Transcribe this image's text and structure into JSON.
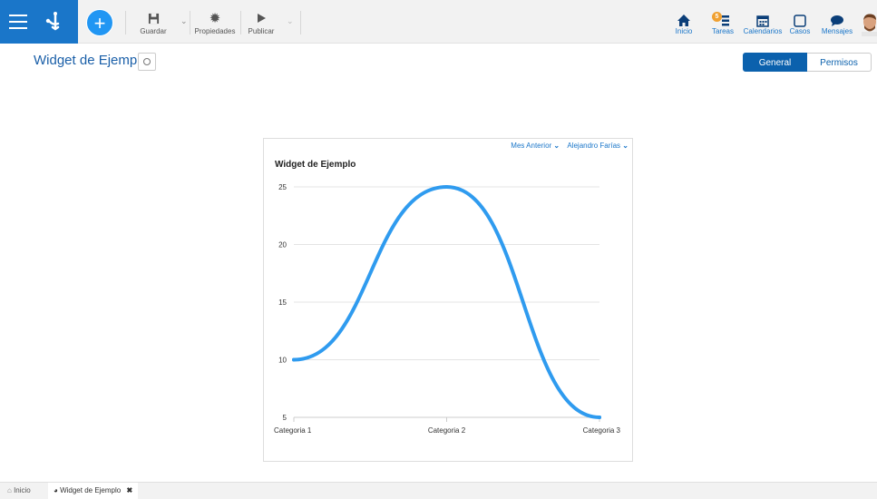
{
  "toolbar": {
    "save_label": "Guardar",
    "properties_label": "Propiedades",
    "publish_label": "Publicar",
    "add_label": "+"
  },
  "nav": {
    "home_label": "Inicio",
    "tasks_label": "Tareas",
    "tasks_badge": "5",
    "calendars_label": "Calendarios",
    "cases_label": "Casos",
    "messages_label": "Mensajes"
  },
  "page": {
    "title": "Widget de Ejemplo"
  },
  "tabs": {
    "general": "General",
    "permissions": "Permisos"
  },
  "widget": {
    "filter_period": "Mes Anterior",
    "filter_user": "Alejandro Farías",
    "title": "Widget de Ejemplo"
  },
  "chart_data": {
    "type": "line",
    "title": "Widget de Ejemplo",
    "categories": [
      "Categoria 1",
      "Categoria 2",
      "Categoria 3"
    ],
    "series": [
      {
        "values": [
          10,
          25,
          5
        ]
      }
    ],
    "ylim": [
      5,
      25
    ],
    "yticks": [
      5,
      10,
      15,
      20,
      25
    ],
    "grid": true,
    "smooth": true,
    "color": "#2f9bef"
  },
  "bottom_tabs": {
    "home": "Inicio",
    "widget": "Widget de Ejemplo"
  },
  "colors": {
    "brand": "#1a76c9",
    "accent": "#2196f3",
    "tab_active": "#0b61ad"
  }
}
